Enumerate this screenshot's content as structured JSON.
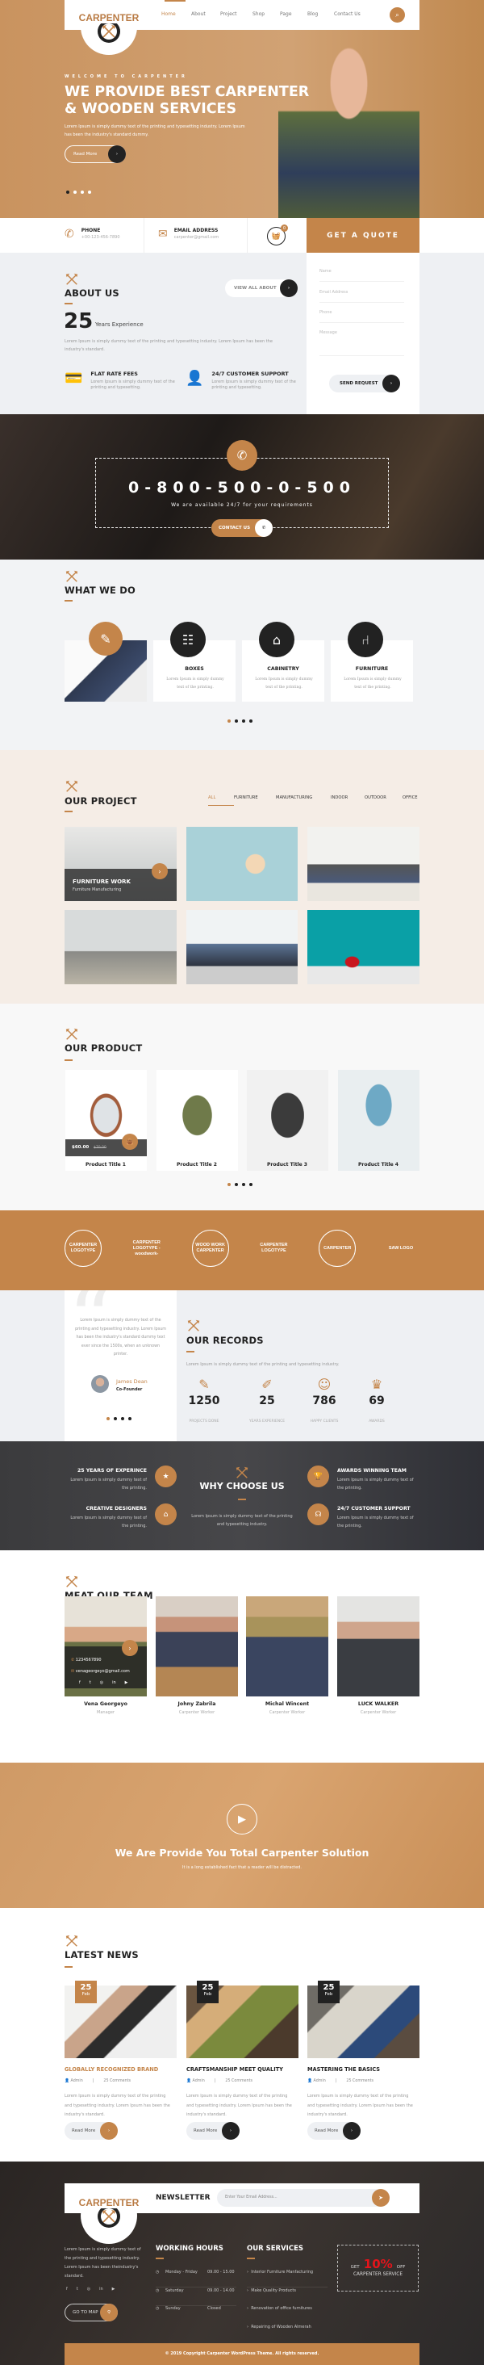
{
  "brand": {
    "name": "CARPENTER",
    "accent": "#c4854a",
    "dark": "#232323"
  },
  "nav": {
    "items": [
      "Home",
      "About",
      "Project",
      "Shop",
      "Page",
      "Blog",
      "Contact Us"
    ],
    "active": "Home"
  },
  "hero": {
    "kicker": "WELCOME TO CARPENTER",
    "title1": "WE PROVIDE BEST CARPENTER",
    "title2": "& WOODEN SERVICES",
    "desc1": "Lorem Ipsum is simply dummy text of the printing and typesetting industry. Lorem Ipsum",
    "desc2": "has been the industry's standard dummy.",
    "read_more": "Read More",
    "slide_count": 4,
    "active_slide": 1
  },
  "info": {
    "phone_label": "PHONE",
    "phone": "+00-123-456-7890",
    "email_label": "EMAIL ADDRESS",
    "email": "carpenter@gmail.com",
    "cart_count": "0",
    "quote": "GET A QUOTE"
  },
  "about": {
    "title": "ABOUT US",
    "view_all": "VIEW ALL ABOUT",
    "years": "25",
    "years_label": "Years Experience",
    "desc": "Lorem Ipsum is simply dummy text of the printing and typesetting industry. Lorem Ipsum has been the industry's standard.",
    "features": [
      {
        "title": "FLAT RATE FEES",
        "desc": "Lorem Ipsum is simply dummy text of the printing and typesetting."
      },
      {
        "title": "24/7 CUSTOMER SUPPORT",
        "desc": "Lorem Ipsum is simply dummy text of the printing and typesetting."
      }
    ]
  },
  "form": {
    "name": "Name",
    "email": "Email Address",
    "phone": "Phone",
    "message": "Message",
    "submit": "SEND REQUEST"
  },
  "call": {
    "number": "0-800-500-0-500",
    "sub": "We are available 24/7 for your requirements",
    "button": "CONTACT US"
  },
  "services": {
    "title": "WHAT WE DO",
    "items": [
      {
        "title": "BOXES",
        "desc": "Lorem Ipsum is simply dummy text of the printing."
      },
      {
        "title": "CABINETRY",
        "desc": "Lorem Ipsum is simply dummy text of the printing."
      },
      {
        "title": "FURNITURE",
        "desc": "Lorem Ipsum is simply dummy text of the printing."
      }
    ]
  },
  "projects": {
    "title": "OUR PROJECT",
    "filters": [
      "ALL",
      "FURNITURE",
      "MANUFACTURING",
      "INDOOR",
      "OUTDOOR",
      "OFFICE"
    ],
    "active_filter": "ALL",
    "featured_title": "FURNITURE WORK",
    "featured_sub": "Furniture Manufacturing"
  },
  "products": {
    "title": "OUR PRODUCT",
    "price": "$60.00",
    "old_price": "$70.00",
    "items": [
      "Product Title 1",
      "Product Title 2",
      "Product Title 3",
      "Product Title 4"
    ]
  },
  "logos": [
    "CARPENTER LOGOTYPE",
    "CARPENTER LOGOTYPE -woodwork-",
    "WOOD WORK CARPENTER",
    "CARPENTER LOGOTYPE",
    "CARPENTER",
    "SAW LOGO"
  ],
  "testimonial": {
    "quote": "Lorem Ipsum is simply dummy text of the printing and typesetting industry. Lorem Ipsum has been the industry's standard dummy text ever since the 1500s, when an unknown printer.",
    "name": "James Dean",
    "role": "Co-Founder"
  },
  "records": {
    "title": "OUR RECORDS",
    "desc": "Lorem Ipsum is simply dummy text of the printing and typesetting industry.",
    "items": [
      {
        "value": "1250",
        "label": "PROJECTS DONE"
      },
      {
        "value": "25",
        "label": "YEARS EXPERIENCE"
      },
      {
        "value": "786",
        "label": "HAPPY CLIENTS"
      },
      {
        "value": "69",
        "label": "AWARDS"
      }
    ]
  },
  "why": {
    "title": "WHY CHOOSE US",
    "desc": "Lorem Ipsum is simply dummy text of the printing and typesetting industry.",
    "items": [
      {
        "title": "25 YEARS OF EXPERINCE",
        "desc": "Lorem Ipsum is simply dummy text of the printing."
      },
      {
        "title": "CREATIVE DESIGNERS",
        "desc": "Lorem Ipsum is simply dummy text of the printing."
      },
      {
        "title": "AWARDS WINNING TEAM",
        "desc": "Lorem Ipsum is simply dummy text of the printing."
      },
      {
        "title": "24/7 CUSTOMER SUPPORT",
        "desc": "Lorem Ipsum is simply dummy text of the printing."
      }
    ]
  },
  "team": {
    "title": "MEAT OUR TEAM",
    "phone": "1234567890",
    "email": "venageorgeyo@gmail.com",
    "members": [
      {
        "name": "Vena Georgeyo",
        "role": "Manager"
      },
      {
        "name": "Johny Zabrila",
        "role": "Carpenter Worker"
      },
      {
        "name": "Michal Wincent",
        "role": "Carpenter Worker"
      },
      {
        "name": "LUCK WALKER",
        "role": "Carpenter Worker"
      }
    ]
  },
  "video": {
    "title": "We Are Provide You Total Carpenter Solution",
    "sub": "It is a long established fact that a reader will be distracted."
  },
  "news": {
    "title": "LATEST NEWS",
    "read_more": "Read More",
    "posts": [
      {
        "day": "25",
        "month": "Feb",
        "title": "GLOBALLY RECOGNIZED BRAND",
        "author": "Admin",
        "comments": "25 Comments",
        "desc": "Lorem Ipsum is simply dummy text of the printing and typesetting industry. Lorem Ipsum has been the industry's standard."
      },
      {
        "day": "25",
        "month": "Feb",
        "title": "CRAFTSMANSHIP MEET QUALITY",
        "author": "Admin",
        "comments": "25 Comments",
        "desc": "Lorem Ipsum is simply dummy text of the printing and typesetting industry. Lorem Ipsum has been the industry's standard."
      },
      {
        "day": "25",
        "month": "Feb",
        "title": "MASTERING THE BASICS",
        "author": "Admin",
        "comments": "25 Comments",
        "desc": "Lorem Ipsum is simply dummy text of the printing and typesetting industry. Lorem Ipsum has been the industry's standard."
      }
    ]
  },
  "footer": {
    "newsletter": "NEWSLETTER",
    "email_placeholder": "Enter Your Email Address...",
    "about": "Lorem Ipsum is simply dummy text of the printing and typesetting industry. Lorem Ipsum has been theindustry's standard.",
    "map": "GO TO MAP",
    "hours_title": "WORKING HOURS",
    "hours": [
      {
        "day": "Monday - Friday",
        "time": "09.00 - 15.00"
      },
      {
        "day": "Saturday",
        "time": "09.00 - 14.00"
      },
      {
        "day": "Sunday",
        "time": "Closed"
      }
    ],
    "services_title": "OUR SERVICES",
    "services": [
      "Interior Furniture Manfacturing",
      "Make Quality Products",
      "Renovation of office furnitures",
      "Repairing of Wooden Almerah"
    ],
    "promo_get": "GET",
    "promo_pct": "10%",
    "promo_off": "OFF",
    "promo_sub": "CARPENTER SERVICE",
    "copyright": "© 2019 Copyright Carpenter WordPress Theme. All rights reserved."
  }
}
